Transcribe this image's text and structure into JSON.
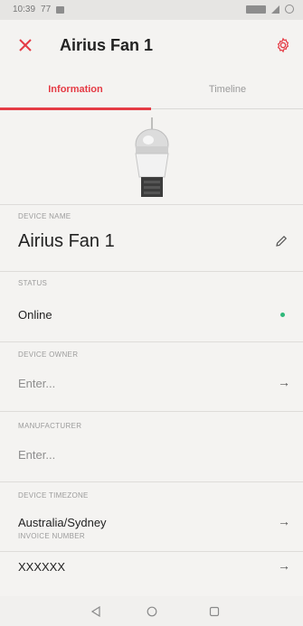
{
  "status_bar": {
    "time": "10:39",
    "extra": "77"
  },
  "header": {
    "title": "Airius Fan 1"
  },
  "tabs": [
    {
      "label": "Information",
      "active": true
    },
    {
      "label": "Timeline",
      "active": false
    }
  ],
  "fields": {
    "device_name": {
      "label": "DEVICE NAME",
      "value": "Airius Fan 1"
    },
    "status": {
      "label": "STATUS",
      "value": "Online",
      "indicator_color": "#2fb87a"
    },
    "device_owner": {
      "label": "DEVICE OWNER",
      "placeholder": "Enter..."
    },
    "manufacturer": {
      "label": "MANUFACTURER",
      "placeholder": "Enter..."
    },
    "device_timezone": {
      "label": "DEVICE TIMEZONE",
      "value": "Australia/Sydney"
    },
    "invoice_number": {
      "label": "INVOICE NUMBER",
      "value": "XXXXXX"
    }
  },
  "colors": {
    "accent": "#e53b45",
    "online": "#2fb87a"
  }
}
